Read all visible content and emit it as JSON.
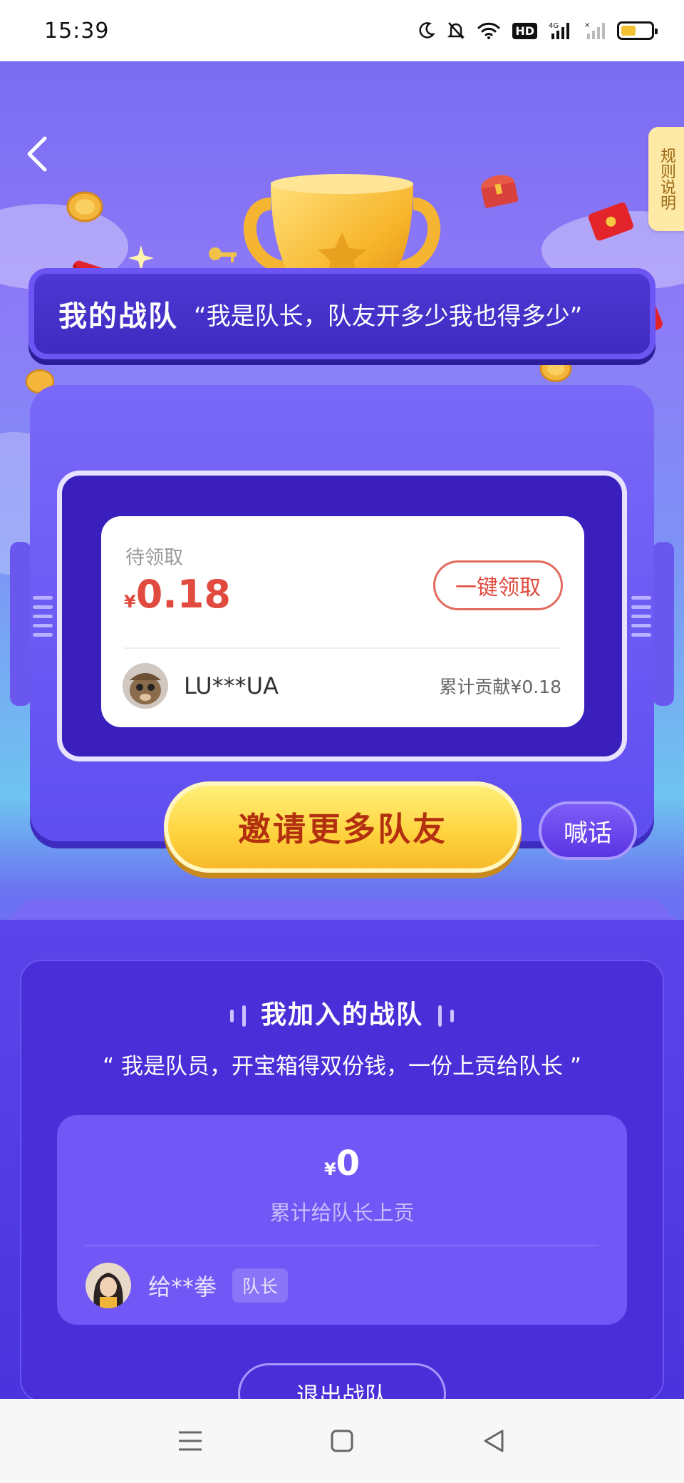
{
  "status_bar": {
    "time": "15:39",
    "hd_label": "HD",
    "network_label": "4G",
    "icons": [
      "moon-icon",
      "bell-off-icon",
      "wifi-icon",
      "hd-icon",
      "signal-icon",
      "signal-off-icon",
      "battery-icon"
    ],
    "battery_level": 0.5
  },
  "header": {
    "back_icon": "chevron-left-icon",
    "rules_label": "规则说明"
  },
  "team_banner": {
    "title": "我的战队",
    "slogan": "“我是队长，队友开多少我也得多少”"
  },
  "my_team_card": {
    "pending_label": "待领取",
    "currency": "¥",
    "pending_amount": "0.18",
    "claim_button": "一键领取",
    "member": {
      "name": "LU***UA",
      "contribution": "累计贡献¥0.18"
    }
  },
  "actions": {
    "invite_button": "邀请更多队友",
    "shout_button": "喊话"
  },
  "joined_team": {
    "title": "我加入的战队",
    "slogan": "“ 我是队员，开宝箱得双份钱，一份上贡给队长 ”",
    "currency": "¥",
    "amount": "0",
    "amount_label": "累计给队长上贡",
    "leader_name": "给**拳",
    "leader_badge": "队长",
    "exit_button": "退出战队"
  },
  "nav_bar": {
    "icons": [
      "menu-icon",
      "home-square-icon",
      "back-triangle-icon"
    ]
  },
  "colors": {
    "accent_red": "#e14a3e",
    "brand_purple": "#5b44ea",
    "invite_yellow": "#ffd23d",
    "rules_tab": "#ffe9a6"
  }
}
